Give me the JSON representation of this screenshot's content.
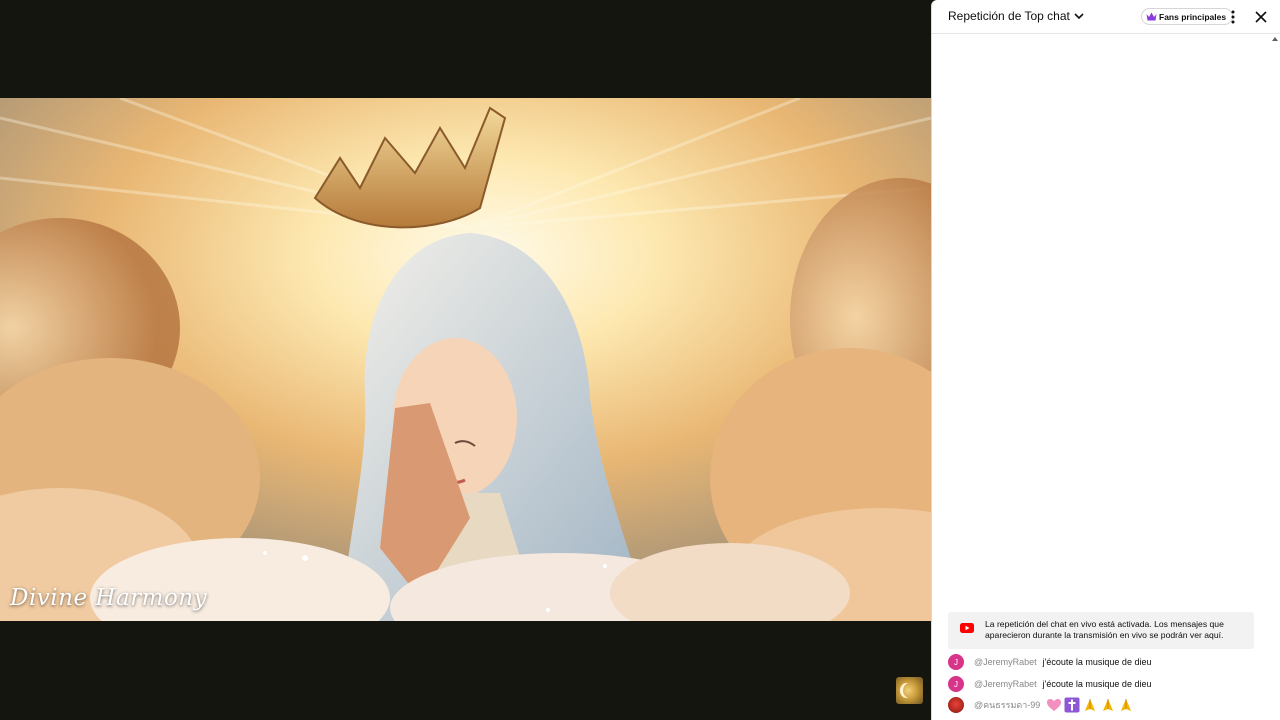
{
  "video": {
    "watermark": "Divine Harmony"
  },
  "chat": {
    "title": "Repetición de Top chat",
    "fans_button": "Fans principales",
    "notice": "La repetición del chat en vivo está activada. Los mensajes que aparecieron durante la transmisión en vivo se podrán ver aquí.",
    "messages": [
      {
        "avatar": "J",
        "author": "@JeremyRabet",
        "text": "j'écoute la musique de dieu"
      },
      {
        "avatar": "J",
        "author": "@JeremyRabet",
        "text": "j'écoute la musique de dieu"
      },
      {
        "avatar": "",
        "author": "@คนธรรมดา-99",
        "text": "",
        "emojis": [
          "pink-heart",
          "latin-cross",
          "folded-hands",
          "folded-hands",
          "folded-hands"
        ]
      }
    ]
  },
  "colors": {
    "accent_red": "#ff0000",
    "avatar_pink": "#d7348a",
    "crown_purple": "#8a3ce0"
  }
}
